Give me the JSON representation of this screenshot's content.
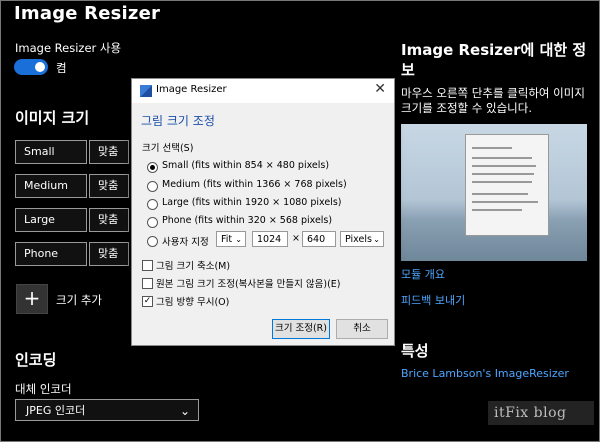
{
  "app_title": "Image Resizer",
  "enable_label": "Image Resizer 사용",
  "toggle_state": "켬",
  "sizes_heading": "이미지 크기",
  "sizes": [
    {
      "name": "Small",
      "fit": "맞춤"
    },
    {
      "name": "Medium",
      "fit": "맞춤"
    },
    {
      "name": "Large",
      "fit": "맞춤"
    },
    {
      "name": "Phone",
      "fit": "맞춤"
    }
  ],
  "add_size_label": "크기 추가",
  "add_icon": "+",
  "encoding_heading": "인코딩",
  "fallback_encoder_label": "대체 인코더",
  "fallback_encoder_value": "JPEG 인코더",
  "chevron": "⌄",
  "about_heading": "Image Resizer에 대한 정보",
  "about_text": "마우스 오른쪽 단추를 클릭하여 이미지 크기를 조정할 수 있습니다.",
  "module_overview_link": "모듈 개요",
  "feedback_link": "피드백 보내기",
  "features_heading": "특성",
  "credit_link": "Brice Lambson's ImageResizer",
  "watermark": "itFix blog",
  "dialog": {
    "title": "Image Resizer",
    "close": "✕",
    "heading": "그림 크기 조정",
    "select_size_label": "크기 선택(S)",
    "options": [
      "Small (fits within 854 × 480 pixels)",
      "Medium (fits within 1366 × 768 pixels)",
      "Large (fits within 1920 × 1080 pixels)",
      "Phone (fits within 320 × 568 pixels)"
    ],
    "custom_label": "사용자 지정",
    "custom_fit": "Fit",
    "custom_width": "1024",
    "custom_times": "×",
    "custom_height": "640",
    "custom_unit": "Pixels",
    "checkbox_shrink": "그림 크기 축소(M)",
    "checkbox_original": "원본 그림 크기 조정(복사본을 만들지 않음)(E)",
    "checkbox_orientation": "그림 방향 무시(O)",
    "checkmark": "✓",
    "resize_button": "크기 조정(R)",
    "cancel_button": "취소"
  }
}
